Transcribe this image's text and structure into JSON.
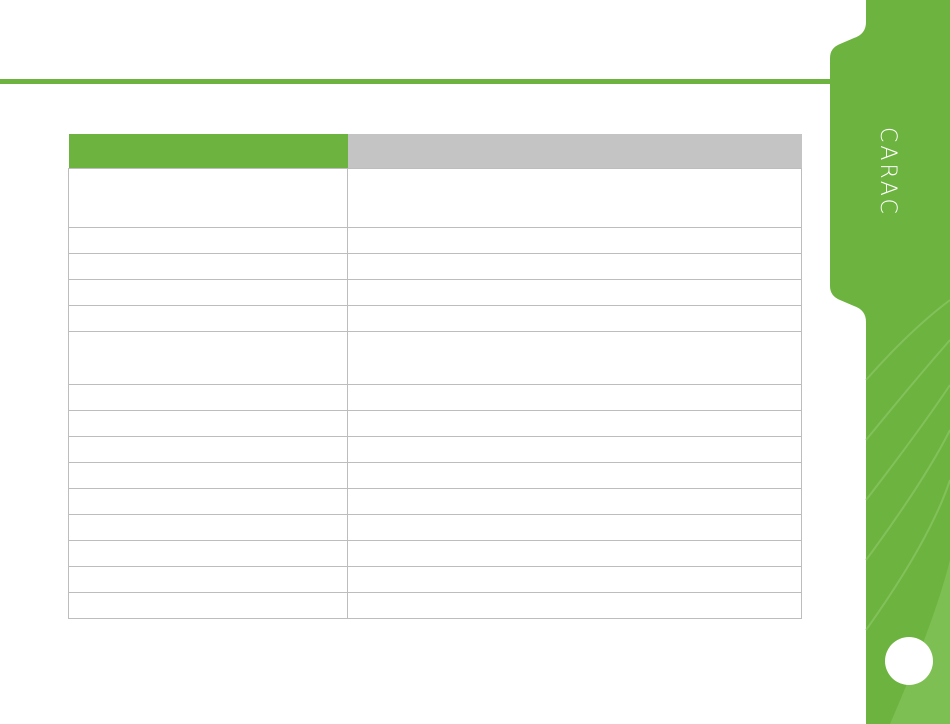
{
  "side_tab": {
    "label": "CARAC"
  },
  "table": {
    "header": [
      "",
      ""
    ],
    "rows": [
      [
        "",
        ""
      ],
      [
        "",
        ""
      ],
      [
        "",
        ""
      ],
      [
        "",
        ""
      ],
      [
        "",
        ""
      ],
      [
        "",
        ""
      ],
      [
        "",
        ""
      ],
      [
        "",
        ""
      ],
      [
        "",
        ""
      ],
      [
        "",
        ""
      ],
      [
        "",
        ""
      ],
      [
        "",
        ""
      ],
      [
        "",
        ""
      ],
      [
        "",
        ""
      ],
      [
        "",
        ""
      ]
    ]
  },
  "colors": {
    "accent_green": "#6db33f",
    "header_gray": "#c4c4c4",
    "border_gray": "#bdbdbd"
  }
}
